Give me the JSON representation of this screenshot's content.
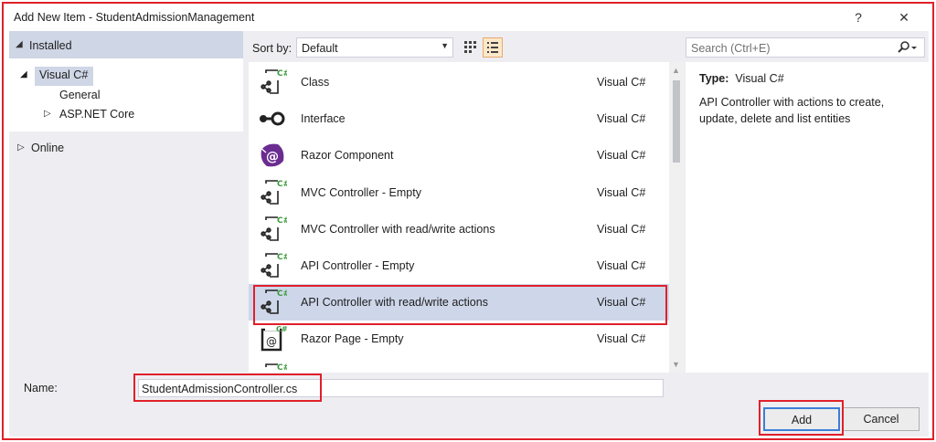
{
  "window": {
    "title": "Add New Item - StudentAdmissionManagement",
    "help_glyph": "?",
    "close_glyph": "✕"
  },
  "left": {
    "installed": "Installed",
    "tree": [
      {
        "label": "Visual C#",
        "expanded": true,
        "selected": true
      },
      {
        "label": "General"
      },
      {
        "label": "ASP.NET Core",
        "expanded": false
      }
    ],
    "online": "Online"
  },
  "toolbar": {
    "sort_label": "Sort by:",
    "sort_value": "Default",
    "view_grid_icon": "grid-view-icon",
    "view_list_icon": "list-view-icon"
  },
  "search": {
    "placeholder": "Search (Ctrl+E)",
    "icon": "search-icon"
  },
  "templates": [
    {
      "name": "Class",
      "lang": "Visual C#",
      "icon": "csharp-class-icon"
    },
    {
      "name": "Interface",
      "lang": "Visual C#",
      "icon": "interface-icon"
    },
    {
      "name": "Razor Component",
      "lang": "Visual C#",
      "icon": "razor-component-icon"
    },
    {
      "name": "MVC Controller - Empty",
      "lang": "Visual C#",
      "icon": "csharp-class-icon"
    },
    {
      "name": "MVC Controller with read/write actions",
      "lang": "Visual C#",
      "icon": "csharp-class-icon"
    },
    {
      "name": "API Controller - Empty",
      "lang": "Visual C#",
      "icon": "csharp-class-icon"
    },
    {
      "name": "API Controller with read/write actions",
      "lang": "Visual C#",
      "icon": "csharp-class-icon",
      "selected": true
    },
    {
      "name": "Razor Page - Empty",
      "lang": "Visual C#",
      "icon": "razor-page-icon"
    }
  ],
  "details": {
    "type_label": "Type:",
    "type_value": "Visual C#",
    "description": "API Controller with actions to create, update, delete and list entities"
  },
  "bottom": {
    "name_label": "Name:",
    "name_value": "StudentAdmissionController.cs",
    "add_label": "Add",
    "cancel_label": "Cancel"
  },
  "colors": {
    "highlight": "#e0202a",
    "selection": "#ced7ea",
    "accent": "#3c7fd6",
    "csharp_green": "#3c9a3c"
  }
}
